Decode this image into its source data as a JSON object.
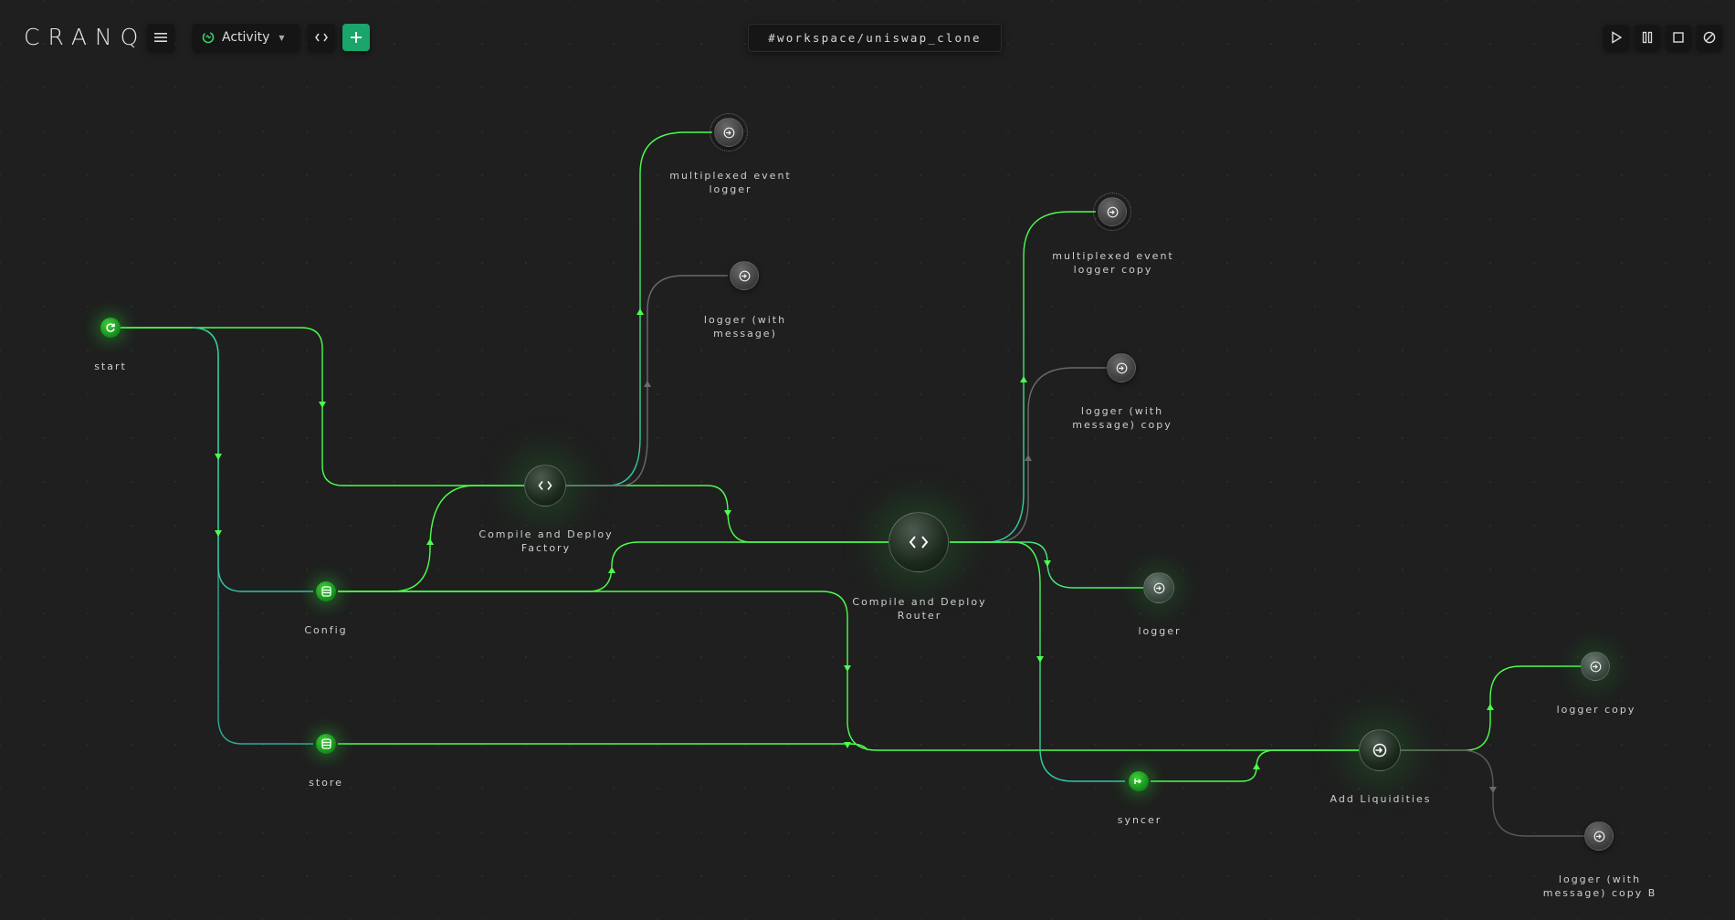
{
  "app": {
    "logo": "CRANQ"
  },
  "toolbar": {
    "activity_label": "Activity",
    "workspace_path": "#workspace/uniswap_clone"
  },
  "icons": {
    "menu": "hamburger-menu-icon",
    "activity": "activity-spinner-icon",
    "code": "code-brackets-icon",
    "add": "plus-icon",
    "run": "play-icon",
    "pause": "pause-icon",
    "stop": "stop-icon",
    "disable": "no-entry-icon"
  },
  "colors": {
    "accent": "#1aa56b",
    "active_node": "#2fb830",
    "edge_active": "#4cff4c",
    "edge_data": "#3ad0b0"
  },
  "nodes": {
    "start": {
      "label": "start"
    },
    "config": {
      "label": "Config"
    },
    "store": {
      "label": "store"
    },
    "compile_factory": {
      "label": "Compile and Deploy\nFactory"
    },
    "compile_router": {
      "label": "Compile and Deploy\nRouter"
    },
    "mux_logger": {
      "label": "multiplexed event\nlogger"
    },
    "logger_msg": {
      "label": "logger (with\nmessage)"
    },
    "mux_logger_copy": {
      "label": "multiplexed event\nlogger copy"
    },
    "logger_msg_copy": {
      "label": "logger (with\nmessage) copy"
    },
    "logger": {
      "label": "logger"
    },
    "syncer": {
      "label": "syncer"
    },
    "add_liquidities": {
      "label": "Add Liquidities"
    },
    "logger_copy": {
      "label": "logger copy"
    },
    "logger_msg_copy_b": {
      "label": "logger (with\nmessage) copy B"
    }
  }
}
